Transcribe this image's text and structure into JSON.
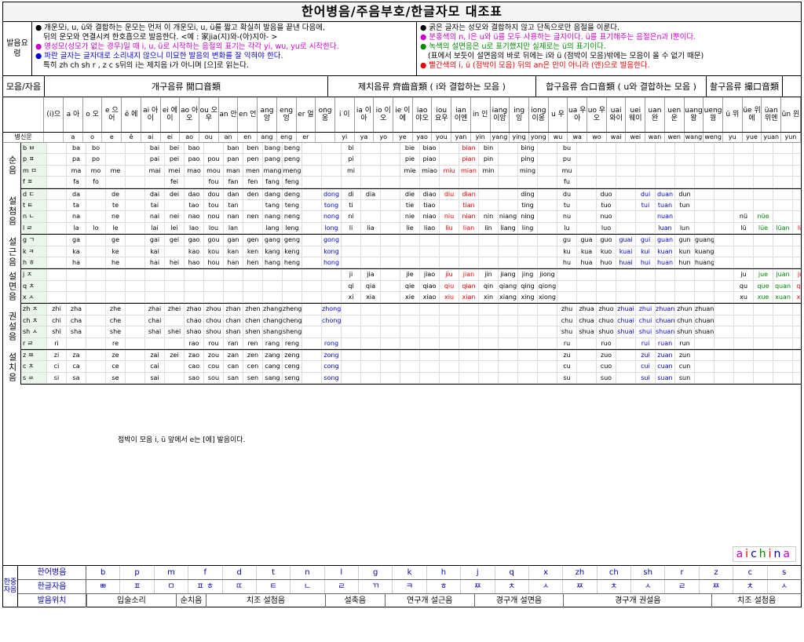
{
  "title": "한어병음/주음부호/한글자모 대조표",
  "notes": {
    "label": "발음요령",
    "left": [
      "● 개운모i, u, ü와 결합하는 운모는 먼저 이 개운모i, u, ü를 짧고 확실히 발음을 끝낸 다음에,",
      "뒤의 운모와 연결시켜 한호흡으로 발음한다. <예 : 家jia(지)와-(아)지아- >",
      "● 영성모(성모가 없는 경우)일 때 i, u, ü로 시작하는 음절의 표기는 각각 yi, wu, yu로 시작한다.",
      "● 파란 글자는 글자대로 소리내지 않으니 미묘한 발음의 변화를 잘 익혀야 한다.",
      "특히 zh ch sh r , z c s뒤의 i는 제치음 i가 아니며 [으]로 읽는다."
    ],
    "right": [
      "● 굵은 글자는 성모와 결합하지 않고 단독으로만 음절을 이룬다.",
      "● 분홍색의 n, l은 u와 ü를 모두 사용하는 글자이다. ü를 표기해주는 음절은n과 l뿐이다.",
      "● 녹색의 설면음은 u로 표기했지만 실제로는 ü의 표기이다.",
      "(표에서 보듯이 설면음의 바로 뒤에는 i와 ü (점박이 모음)밖에는 모음이 올 수 없기 때문)",
      "● 빨간색의 i, ü (점박이 모음) 뒤의 an은 안이 아니라 (앤)으로 발음한다."
    ]
  },
  "groups": [
    {
      "label": "개구음류 開口音類"
    },
    {
      "label": "제치음류 齊齒音類 ( i와 결합하는 모음 )"
    },
    {
      "label": "합구음류 合口音類 ( u와 결합하는 모음 )"
    },
    {
      "label": "촬구음류 撮口音類"
    }
  ],
  "corner": "모음/자음",
  "finals": [
    "(i)으",
    "a 아",
    "o 오",
    "e 으어",
    "ê 에",
    "ai 아이",
    "ei 에이",
    "ao 아오",
    "ou 오우",
    "an 안",
    "en 언",
    "ang 앙",
    "eng 엉",
    "er 얼",
    "ong 옹",
    "i 이",
    "ia 이아",
    "io 이오",
    "ie 이에",
    "iao 야오",
    "iou 요우",
    "ian 이엔",
    "in 인",
    "iang 이앙",
    "ing 잉",
    "iong 이옹",
    "u 우",
    "ua 우아",
    "uo 우오",
    "uai 와이",
    "uei 웨이",
    "uan 완",
    "uen 운",
    "uang 왕",
    "ueng 웡",
    "ü 위",
    "üe 위에",
    "üan 위엔",
    "ün 윈"
  ],
  "meta_labels": [
    "주음부호",
    "병신문",
    "표음성분자"
  ],
  "yrow": [
    "",
    "a",
    "o",
    "e",
    "ê",
    "ai",
    "ei",
    "ao",
    "ou",
    "an",
    "en",
    "ang",
    "eng",
    "er",
    "",
    "yi",
    "ya",
    "yo",
    "ye",
    "yao",
    "you",
    "yan",
    "yin",
    "yang",
    "ying",
    "yong",
    "wu",
    "wa",
    "wo",
    "wai",
    "wei",
    "wan",
    "wen",
    "wang",
    "weng",
    "yu",
    "yue",
    "yuan",
    "yun"
  ],
  "sections": [
    {
      "label": "순음",
      "rows": [
        [
          "b ㅂ",
          "",
          "ba",
          "bo",
          "",
          "",
          "bai",
          "bei",
          "bao",
          "",
          "ban",
          "ben",
          "bang",
          "beng",
          "",
          "",
          "bi",
          "",
          "",
          "bie",
          "biao",
          "",
          "bian",
          "bin",
          "",
          "bing",
          "",
          "bu",
          "",
          "",
          "",
          "",
          "",
          "",
          "",
          "",
          "",
          "",
          "",
          ""
        ],
        [
          "p ㅍ",
          "",
          "pa",
          "po",
          "",
          "",
          "pai",
          "pei",
          "pao",
          "pou",
          "pan",
          "pen",
          "pang",
          "peng",
          "",
          "",
          "pi",
          "",
          "",
          "pie",
          "piao",
          "",
          "pian",
          "pin",
          "",
          "ping",
          "",
          "pu",
          "",
          "",
          "",
          "",
          "",
          "",
          "",
          "",
          "",
          "",
          "",
          ""
        ],
        [
          "m ㅁ",
          "",
          "ma",
          "mo",
          "me",
          "",
          "mai",
          "mei",
          "mao",
          "mou",
          "man",
          "men",
          "mang",
          "meng",
          "",
          "",
          "mi",
          "",
          "",
          "mie",
          "miao",
          "miu",
          "mian",
          "min",
          "",
          "ming",
          "",
          "mu",
          "",
          "",
          "",
          "",
          "",
          "",
          "",
          "",
          "",
          "",
          "",
          ""
        ],
        [
          "f ㅍ",
          "",
          "fa",
          "fo",
          "",
          "",
          "",
          "fei",
          "",
          "fou",
          "fan",
          "fen",
          "fang",
          "feng",
          "",
          "",
          "",
          "",
          "",
          "",
          "",
          "",
          "",
          "",
          "",
          "",
          "",
          "fu",
          "",
          "",
          "",
          "",
          "",
          "",
          "",
          "",
          "",
          "",
          "",
          ""
        ]
      ]
    },
    {
      "label": "설첨음",
      "rows": [
        [
          "d ㄷ",
          "",
          "da",
          "",
          "de",
          "",
          "dai",
          "dei",
          "dao",
          "dou",
          "dan",
          "den",
          "dang",
          "deng",
          "",
          "dong",
          "di",
          "dia",
          "",
          "die",
          "diao",
          "diu",
          "dian",
          "",
          "",
          "ding",
          "",
          "du",
          "",
          "duo",
          "",
          "dui",
          "duan",
          "dun",
          "",
          "",
          "",
          "",
          "",
          ""
        ],
        [
          "t ㅌ",
          "",
          "ta",
          "",
          "te",
          "",
          "tai",
          "",
          "tao",
          "tou",
          "tan",
          "",
          "tang",
          "teng",
          "",
          "tong",
          "ti",
          "",
          "",
          "tie",
          "tiao",
          "",
          "tian",
          "",
          "",
          "ting",
          "",
          "tu",
          "",
          "tuo",
          "",
          "tui",
          "tuan",
          "tun",
          "",
          "",
          "",
          "",
          "",
          ""
        ],
        [
          "n ㄴ",
          "",
          "na",
          "",
          "ne",
          "",
          "nai",
          "nei",
          "nao",
          "nou",
          "nan",
          "nen",
          "nang",
          "neng",
          "",
          "nong",
          "ni",
          "",
          "",
          "nie",
          "niao",
          "niu",
          "nian",
          "nin",
          "niang",
          "ning",
          "",
          "nu",
          "",
          "nuo",
          "",
          "",
          "nuan",
          "",
          "",
          "",
          "nü",
          "nüe",
          "",
          ""
        ],
        [
          "l ㄹ",
          "",
          "la",
          "lo",
          "le",
          "",
          "lai",
          "lei",
          "lao",
          "lou",
          "lan",
          "",
          "lang",
          "leng",
          "",
          "long",
          "li",
          "lia",
          "",
          "lie",
          "liao",
          "liu",
          "lian",
          "lin",
          "liang",
          "ling",
          "",
          "lu",
          "",
          "luo",
          "",
          "",
          "luan",
          "lun",
          "",
          "",
          "lü",
          "lüe",
          "lüan",
          "lün"
        ]
      ]
    },
    {
      "label": "설근음",
      "rows": [
        [
          "g ㄱ",
          "",
          "ga",
          "",
          "ge",
          "",
          "gai",
          "gei",
          "gao",
          "gou",
          "gan",
          "gen",
          "gang",
          "geng",
          "",
          "gong",
          "",
          "",
          "",
          "",
          "",
          "",
          "",
          "",
          "",
          "",
          "",
          "gu",
          "gua",
          "guo",
          "guai",
          "gui",
          "guan",
          "gun",
          "guang",
          "",
          "",
          "",
          "",
          ""
        ],
        [
          "k ㅋ",
          "",
          "ka",
          "",
          "ke",
          "",
          "kai",
          "",
          "kao",
          "kou",
          "kan",
          "ken",
          "kang",
          "keng",
          "",
          "kong",
          "",
          "",
          "",
          "",
          "",
          "",
          "",
          "",
          "",
          "",
          "",
          "ku",
          "kua",
          "kuo",
          "kuai",
          "kui",
          "kuan",
          "kun",
          "kuang",
          "",
          "",
          "",
          "",
          ""
        ],
        [
          "h ㅎ",
          "",
          "ha",
          "",
          "he",
          "",
          "hai",
          "hei",
          "hao",
          "hou",
          "han",
          "hen",
          "hang",
          "heng",
          "",
          "hong",
          "",
          "",
          "",
          "",
          "",
          "",
          "",
          "",
          "",
          "",
          "",
          "hu",
          "hua",
          "huo",
          "huai",
          "hui",
          "huan",
          "hun",
          "huang",
          "",
          "",
          "",
          "",
          ""
        ]
      ]
    },
    {
      "label": "설면음",
      "rows": [
        [
          "j ㅈ",
          "",
          "",
          "",
          "",
          "",
          "",
          "",
          "",
          "",
          "",
          "",
          "",
          "",
          "",
          "",
          "ji",
          "jia",
          "",
          "jie",
          "jiao",
          "jiu",
          "jian",
          "jin",
          "jiang",
          "jing",
          "jiong",
          "",
          "",
          "",
          "",
          "",
          "",
          "",
          "",
          "",
          "ju",
          "jue",
          "juan",
          "jun"
        ],
        [
          "q ㅊ",
          "",
          "",
          "",
          "",
          "",
          "",
          "",
          "",
          "",
          "",
          "",
          "",
          "",
          "",
          "",
          "qi",
          "qia",
          "",
          "qie",
          "qiao",
          "qiu",
          "qian",
          "qin",
          "qiang",
          "qing",
          "qiong",
          "",
          "",
          "",
          "",
          "",
          "",
          "",
          "",
          "",
          "qu",
          "que",
          "quan",
          "qun"
        ],
        [
          "x ㅅ",
          "",
          "",
          "",
          "",
          "",
          "",
          "",
          "",
          "",
          "",
          "",
          "",
          "",
          "",
          "",
          "xi",
          "xia",
          "",
          "xie",
          "xiao",
          "xiu",
          "xian",
          "xin",
          "xiang",
          "xing",
          "xiong",
          "",
          "",
          "",
          "",
          "",
          "",
          "",
          "",
          "",
          "xu",
          "xue",
          "xuan",
          "xun"
        ]
      ]
    },
    {
      "label": "권설음",
      "rows": [
        [
          "zh ㅈ",
          "zhi",
          "zha",
          "",
          "zhe",
          "",
          "zhai",
          "zhei",
          "zhao",
          "zhou",
          "zhan",
          "zhen",
          "zhang",
          "zheng",
          "",
          "zhong",
          "",
          "",
          "",
          "",
          "",
          "",
          "",
          "",
          "",
          "",
          "",
          "zhu",
          "zhua",
          "zhuo",
          "zhuai",
          "zhui",
          "zhuan",
          "zhun",
          "zhuang",
          "",
          "",
          "",
          "",
          ""
        ],
        [
          "ch ㅊ",
          "chi",
          "cha",
          "",
          "che",
          "",
          "chai",
          "",
          "chao",
          "chou",
          "chan",
          "chen",
          "chang",
          "cheng",
          "",
          "chong",
          "",
          "",
          "",
          "",
          "",
          "",
          "",
          "",
          "",
          "",
          "",
          "chu",
          "chua",
          "chuo",
          "chuai",
          "chui",
          "chuan",
          "chun",
          "chuang",
          "",
          "",
          "",
          "",
          ""
        ],
        [
          "sh ㅅ",
          "shi",
          "sha",
          "",
          "she",
          "",
          "shai",
          "shei",
          "shao",
          "shou",
          "shan",
          "shen",
          "shang",
          "sheng",
          "",
          "",
          "",
          "",
          "",
          "",
          "",
          "",
          "",
          "",
          "",
          "",
          "",
          "shu",
          "shua",
          "shuo",
          "shuai",
          "shui",
          "shuan",
          "shun",
          "shuang",
          "",
          "",
          "",
          "",
          ""
        ],
        [
          "r ㄹ",
          "ri",
          "",
          "",
          "re",
          "",
          "",
          "",
          "rao",
          "rou",
          "ran",
          "ren",
          "rang",
          "reng",
          "",
          "rong",
          "",
          "",
          "",
          "",
          "",
          "",
          "",
          "",
          "",
          "",
          "",
          "ru",
          "",
          "ruo",
          "",
          "rui",
          "ruan",
          "run",
          "",
          "",
          "",
          "",
          "",
          ""
        ]
      ]
    },
    {
      "label": "설치음",
      "rows": [
        [
          "z ㅉ",
          "zi",
          "za",
          "",
          "ze",
          "",
          "zai",
          "zei",
          "zao",
          "zou",
          "zan",
          "zen",
          "zang",
          "zeng",
          "",
          "zong",
          "",
          "",
          "",
          "",
          "",
          "",
          "",
          "",
          "",
          "",
          "",
          "zu",
          "",
          "zuo",
          "",
          "zui",
          "zuan",
          "zun",
          "",
          "",
          "",
          "",
          "",
          ""
        ],
        [
          "c ㅊ",
          "ci",
          "ca",
          "",
          "ce",
          "",
          "cai",
          "",
          "cao",
          "cou",
          "can",
          "cen",
          "cang",
          "ceng",
          "",
          "cong",
          "",
          "",
          "",
          "",
          "",
          "",
          "",
          "",
          "",
          "",
          "",
          "cu",
          "",
          "cuo",
          "",
          "cui",
          "cuan",
          "cun",
          "",
          "",
          "",
          "",
          "",
          ""
        ],
        [
          "s ㅆ",
          "si",
          "sa",
          "",
          "se",
          "",
          "sai",
          "",
          "sao",
          "sou",
          "san",
          "sen",
          "sang",
          "seng",
          "",
          "song",
          "",
          "",
          "",
          "",
          "",
          "",
          "",
          "",
          "",
          "",
          "",
          "su",
          "",
          "suo",
          "",
          "sui",
          "suan",
          "sun",
          "",
          "",
          "",
          "",
          "",
          ""
        ]
      ]
    }
  ],
  "inline_note": "점박이 모음 i, ü 앞에서 e는 [에] 발음이다.",
  "brand": "aichina",
  "bottom": {
    "label": "한중자음",
    "row_labels": [
      "한어병음",
      "한글자음",
      "발음위치"
    ],
    "pinyin": [
      "b",
      "p",
      "m",
      "f",
      "d",
      "t",
      "n",
      "l",
      "g",
      "k",
      "h",
      "j",
      "q",
      "x",
      "zh",
      "ch",
      "sh",
      "r",
      "z",
      "c",
      "s"
    ],
    "hangul": [
      "ㅃ",
      "ㅍ",
      "ㅁ",
      "ㅍ ㅎ",
      "ㄸ",
      "ㅌ",
      "ㄴ",
      "ㄹ",
      "ㄲ",
      "ㅋ",
      "ㅎ",
      "ㅉ",
      "ㅊ",
      "ㅅ",
      "ㅉ",
      "ㅊ",
      "ㅅ",
      "ㄹ",
      "ㅉ",
      "ㅊ",
      "ㅅ"
    ],
    "places": [
      "입술소리",
      "순치음",
      "치조 설첨음",
      "설축음",
      "연구개 설근음",
      "경구개 설면음",
      "경구개 권설음",
      "치조 설첨음"
    ]
  }
}
